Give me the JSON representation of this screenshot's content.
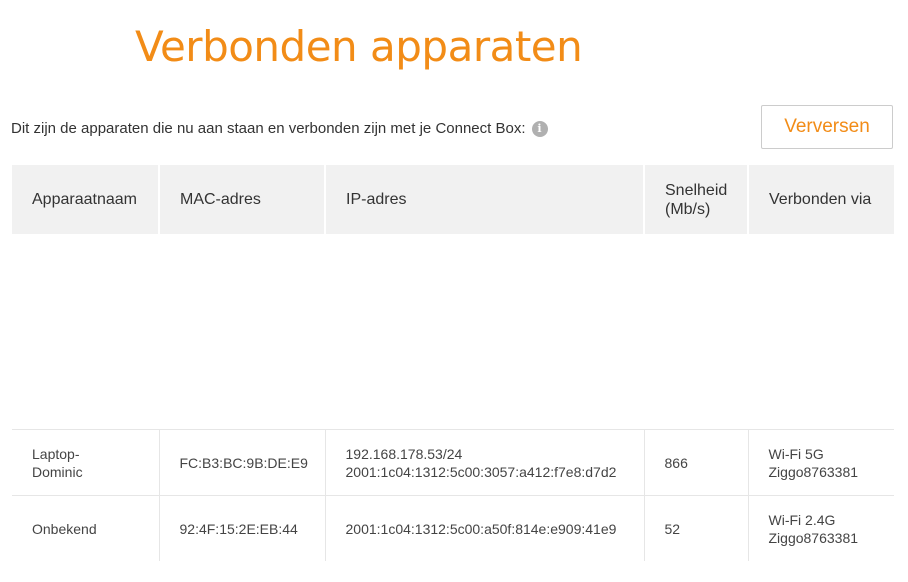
{
  "header": {
    "title": "Verbonden apparaten",
    "intro": "Dit zijn de apparaten die nu aan staan en verbonden zijn met je Connect Box:",
    "info_icon": "info-icon",
    "refresh_label": "Verversen"
  },
  "colors": {
    "accent": "#f28c17",
    "header_bg": "#f1f1f1"
  },
  "table": {
    "columns": [
      "Apparaatnaam",
      "MAC-adres",
      "IP-adres",
      "Snelheid (Mb/s)",
      "Verbonden via"
    ],
    "rows": [
      {
        "name": "Laptop-Dominic",
        "mac": "FC:B3:BC:9B:DE:E9",
        "ip": [
          "192.168.178.53/24",
          "2001:1c04:1312:5c00:3057:a412:f7e8:d7d2"
        ],
        "speed": "866",
        "via": [
          "Wi-Fi 5G",
          "Ziggo8763381"
        ]
      },
      {
        "name": "Onbekend",
        "mac": "92:4F:15:2E:EB:44",
        "ip": [
          "2001:1c04:1312:5c00:a50f:814e:e909:41e9"
        ],
        "speed": "52",
        "via": [
          "Wi-Fi 2.4G",
          "Ziggo8763381"
        ]
      }
    ]
  }
}
